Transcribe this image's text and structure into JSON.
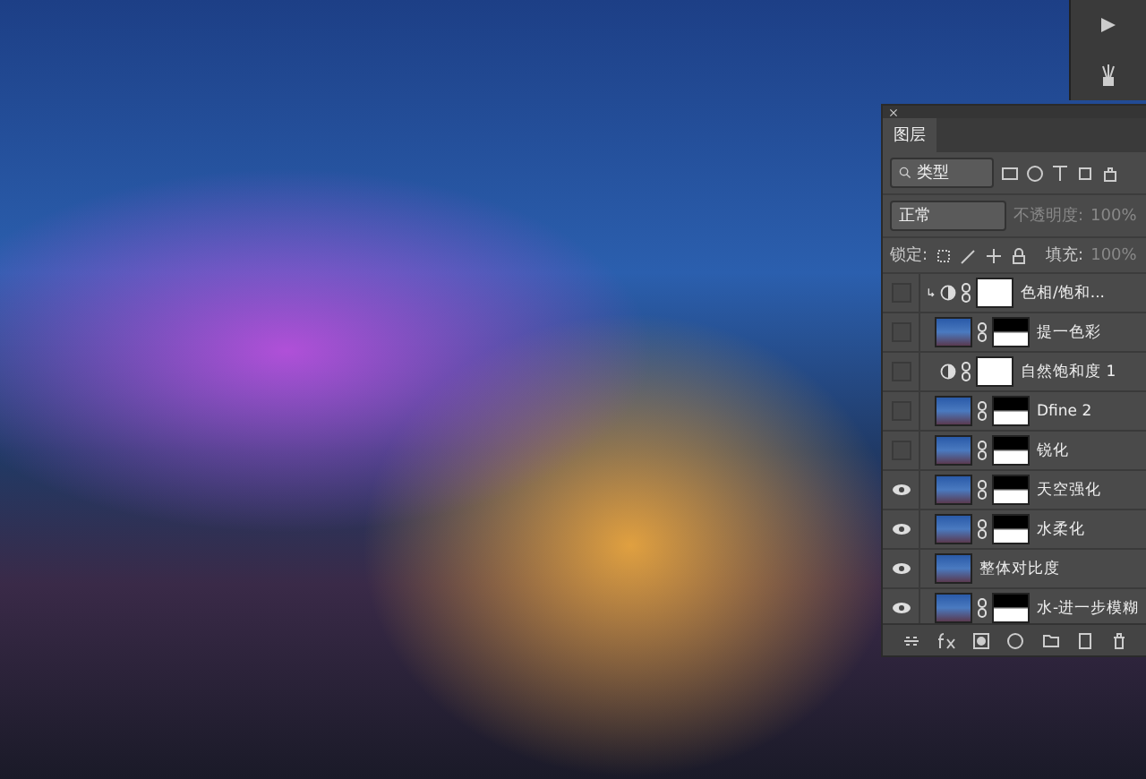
{
  "panel": {
    "tab": "图层",
    "filter": "类型",
    "blend_mode": "正常",
    "opacity_label": "不透明度:",
    "opacity": "100%",
    "lock_label": "锁定:",
    "fill_label": "填充:",
    "fill": "100%"
  },
  "layers": [
    {
      "name": "色相/饱和...",
      "kind": "adjustment",
      "visible": false,
      "clipped": true
    },
    {
      "name": "提一色彩",
      "kind": "smart",
      "visible": false,
      "clipped": false
    },
    {
      "name": "自然饱和度 1",
      "kind": "adjustment",
      "visible": false,
      "clipped": false
    },
    {
      "name": "Dfine 2",
      "kind": "smart",
      "visible": false,
      "clipped": false
    },
    {
      "name": "锐化",
      "kind": "smart",
      "visible": false,
      "clipped": false
    },
    {
      "name": "天空强化",
      "kind": "smart",
      "visible": true,
      "clipped": false
    },
    {
      "name": "水柔化",
      "kind": "smart",
      "visible": true,
      "clipped": false
    },
    {
      "name": "整体对比度",
      "kind": "plain",
      "visible": true,
      "clipped": false
    },
    {
      "name": "水-进一步模糊",
      "kind": "smart",
      "visible": true,
      "clipped": false
    }
  ]
}
